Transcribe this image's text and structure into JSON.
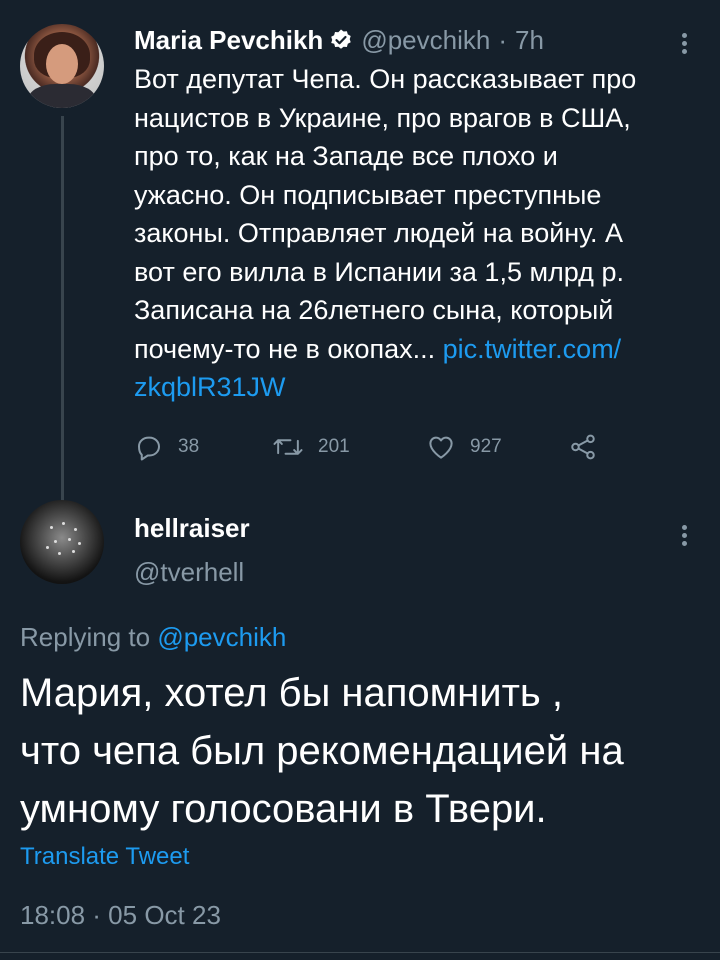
{
  "parent_tweet": {
    "author_name": "Maria Pevchikh",
    "handle": "@pevchikh",
    "separator": "·",
    "time_ago": "7h",
    "text": "Вот депутат Чепа. Он рассказывает про\nнацистов в Украине, про врагов в США,\nпро то, как на Западе все плохо и\nужасно. Он подписывает преступные\nзаконы. Отправляет людей на войну. А\nвот его вилла в Испании за 1,5 млрд р.\nЗаписана на 26летнего сына, который\nпочему-то не в окопах... ",
    "link_text": "pic.twitter.com/\nzkqblR31JW",
    "verified_icon": "verified-badge-icon",
    "actions": {
      "replies": "38",
      "retweets": "201",
      "likes": "927"
    }
  },
  "reply_tweet": {
    "author_name": "hellraiser",
    "handle": "@tverhell",
    "replying_to_label": "Replying to ",
    "replying_to_mention": "@pevchikh",
    "text": "Мария, хотел бы напомнить ,\nчто чепа был рекомендацией на\nумному голосовани  в Твери.",
    "translate_label": "Translate Tweet",
    "timestamp": "18:08 · 05 Oct 23"
  },
  "colors": {
    "background": "#15202b",
    "secondary_text": "#8899a6",
    "link": "#1d9bf0",
    "divider": "#38444d"
  }
}
